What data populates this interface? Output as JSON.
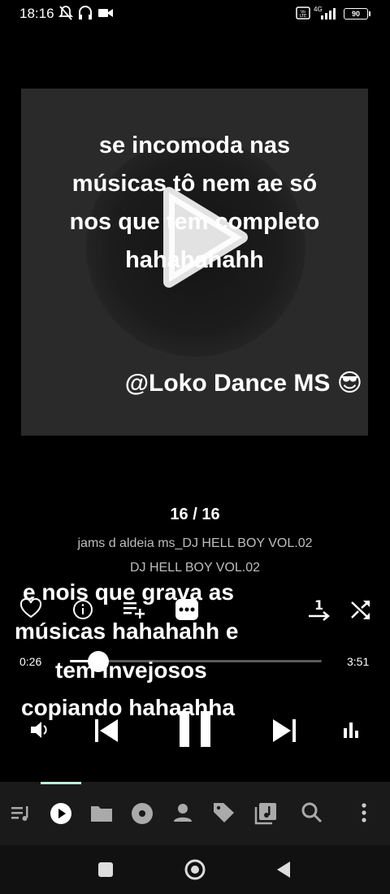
{
  "status_bar": {
    "time": "18:16",
    "battery": "90",
    "network": "4G"
  },
  "artwork": {
    "caption_lines": [
      "se incomoda nas",
      "músicas tô nem ae só",
      "nos que tem completo",
      "hahahahahh"
    ],
    "handle": "@Loko Dance MS 😎"
  },
  "player": {
    "queue_position": "16 / 16",
    "track_title": "jams d aldeia ms_DJ HELL BOY VOL.02",
    "album": "DJ HELL BOY VOL.02",
    "elapsed": "0:26",
    "duration": "3:51",
    "progress_fraction": 0.112,
    "repeat_badge": "1"
  },
  "overlay_caption": {
    "lines": [
      "e nois que grava as",
      "músicas hahahahh e",
      "tem invejosos",
      "copiando hahaahha"
    ]
  },
  "colors": {
    "background": "#000000",
    "nav_background": "#1a1a1a",
    "nav_indicator": "#b6f5d6",
    "muted_text": "#bdbdbd"
  }
}
